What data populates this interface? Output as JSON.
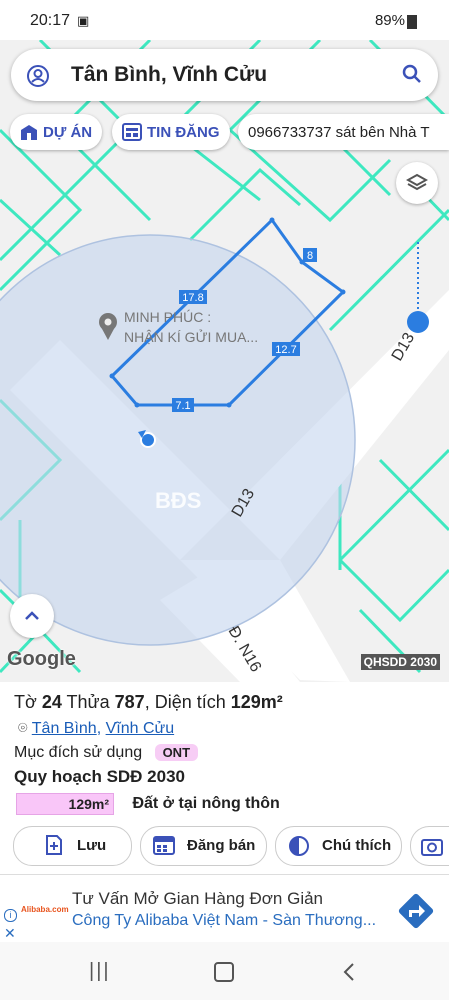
{
  "status": {
    "time": "20:17",
    "battery": "89%"
  },
  "search": {
    "query": "Tân Bình, Vĩnh Cửu"
  },
  "chips": {
    "du_an": "DỰ ÁN",
    "tin_dang": "TIN ĐĂNG",
    "phone": "0966733737 sát bên Nhà T"
  },
  "map": {
    "poi_line1": "MINH PHÚC :",
    "poi_line2": "NHẬN KÍ GỬI MUA...",
    "edges": [
      "17.8",
      "8",
      "12.7",
      "7.1"
    ],
    "roads": [
      "D13",
      "D13",
      "Đ. N16"
    ],
    "watermark": "BĐS",
    "google": "Google",
    "layer_tag": "QHSDD 2030"
  },
  "info": {
    "to_label": "Tờ",
    "to_value": "24",
    "thua_label": "Thửa",
    "thua_value": "787",
    "area_label": ", Diện tích",
    "area_value": "129m²",
    "location1": "Tân Bình",
    "location_sep": ", ",
    "location2": "Vĩnh Cửu",
    "purpose_label": "Mục đích sử dụng",
    "purpose_code": "ONT",
    "plan_title": "Quy hoạch SDĐ 2030",
    "plan_area": "129m²",
    "plan_desc": "Đất ở tại nông thôn"
  },
  "actions": {
    "save": "Lưu",
    "post": "Đăng bán",
    "note": "Chú thích"
  },
  "ad": {
    "brand": "Alibaba.com",
    "title": "Tư Vấn Mở Gian Hàng Đơn Giản",
    "subtitle": "Công Ty Alibaba Việt Nam - Sàn Thương..."
  },
  "colors": {
    "accent": "#3b51b8",
    "road": "#3ee8c0",
    "parcel": "#2b7de0",
    "circle": "#c4d6ee",
    "badge": "#f7cdf5"
  }
}
